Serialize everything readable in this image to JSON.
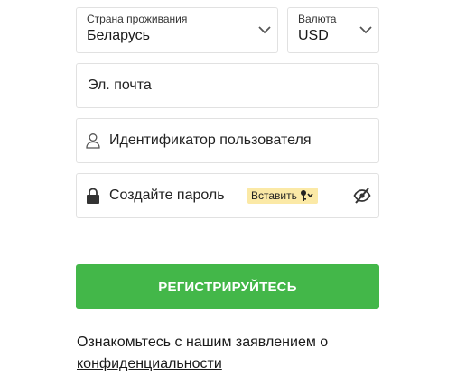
{
  "country_select": {
    "label": "Страна проживания",
    "value": "Беларусь"
  },
  "currency_select": {
    "label": "Валюта",
    "value": "USD"
  },
  "email_field": {
    "placeholder": "Эл. почта"
  },
  "username_field": {
    "placeholder": "Идентификатор пользователя",
    "icon": "user-icon"
  },
  "password_field": {
    "placeholder": "Создайте пароль",
    "icon": "lock-icon",
    "paste_label": "Вставить",
    "paste_icon": "key-icon",
    "visibility_icon": "eye-off-icon"
  },
  "submit_button": {
    "label": "РЕГИСТРИРУЙТЕСЬ",
    "color": "#43b749"
  },
  "privacy": {
    "text": "Ознакомьтесь с нашим заявлением о",
    "link": "конфиденциальности"
  }
}
